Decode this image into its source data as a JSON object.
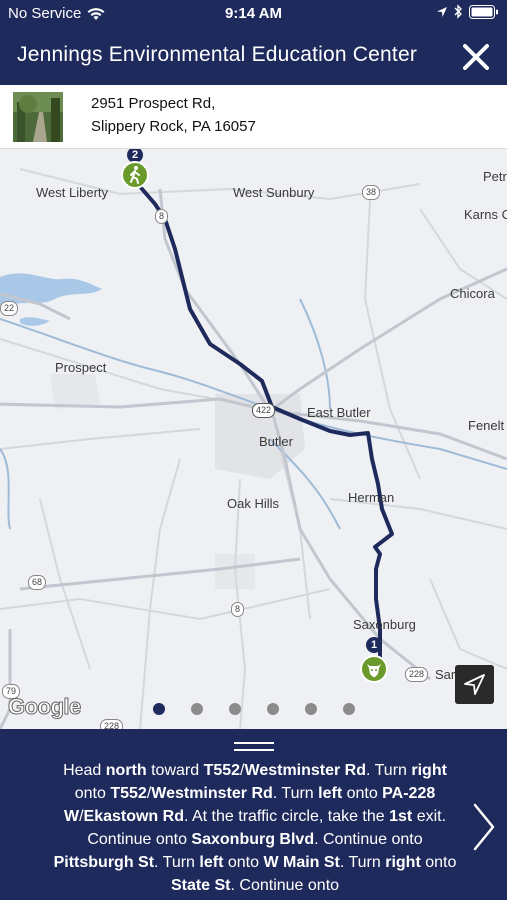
{
  "status_bar": {
    "carrier": "No Service",
    "time": "9:14 AM"
  },
  "header": {
    "title": "Jennings Environmental Education Center",
    "close_icon": "close-icon"
  },
  "address": {
    "line1": "2951 Prospect Rd,",
    "line2": "Slippery Rock, PA 16057"
  },
  "map": {
    "places": [
      "Petr",
      "West Liberty",
      "West Sunbury",
      "Karns C",
      "Chicora",
      "Prospect",
      "East Butler",
      "Butler",
      "Fenelt",
      "Herman",
      "Oak Hills",
      "Saxonburg",
      "Sar"
    ],
    "route_shields": [
      "38",
      "8",
      "22",
      "422",
      "68",
      "8",
      "228",
      "79",
      "228"
    ],
    "markers": [
      {
        "number": "2",
        "icon": "hiker-icon"
      },
      {
        "number": "1",
        "icon": "cow-icon"
      }
    ],
    "attribution": "Google",
    "route_color": "#1f2a5c"
  },
  "pager": {
    "count": 6,
    "active_index": 0
  },
  "directions": {
    "segments": [
      {
        "t": "Head "
      },
      {
        "t": "north",
        "b": true
      },
      {
        "t": " toward "
      },
      {
        "t": "T552",
        "b": true
      },
      {
        "t": "/"
      },
      {
        "t": "Westminster Rd",
        "b": true
      },
      {
        "t": ". Turn "
      },
      {
        "t": "right",
        "b": true
      },
      {
        "t": " onto "
      },
      {
        "t": "T552",
        "b": true
      },
      {
        "t": "/"
      },
      {
        "t": "Westminster Rd",
        "b": true
      },
      {
        "t": ". Turn "
      },
      {
        "t": "left",
        "b": true
      },
      {
        "t": " onto "
      },
      {
        "t": "PA-228 W",
        "b": true
      },
      {
        "t": "/"
      },
      {
        "t": "Ekastown Rd",
        "b": true
      },
      {
        "t": ". At the traffic circle, take the "
      },
      {
        "t": "1st",
        "b": true
      },
      {
        "t": " exit. Continue onto "
      },
      {
        "t": "Saxonburg Blvd",
        "b": true
      },
      {
        "t": ". Continue onto "
      },
      {
        "t": "Pittsburgh St",
        "b": true
      },
      {
        "t": ". Turn "
      },
      {
        "t": "left",
        "b": true
      },
      {
        "t": " onto "
      },
      {
        "t": "W Main St",
        "b": true
      },
      {
        "t": ". Turn "
      },
      {
        "t": "right",
        "b": true
      },
      {
        "t": " onto "
      },
      {
        "t": "State St",
        "b": true
      },
      {
        "t": ". Continue onto"
      }
    ]
  },
  "colors": {
    "brand_navy": "#1f2a5c",
    "marker_green": "#6a9a2b"
  }
}
